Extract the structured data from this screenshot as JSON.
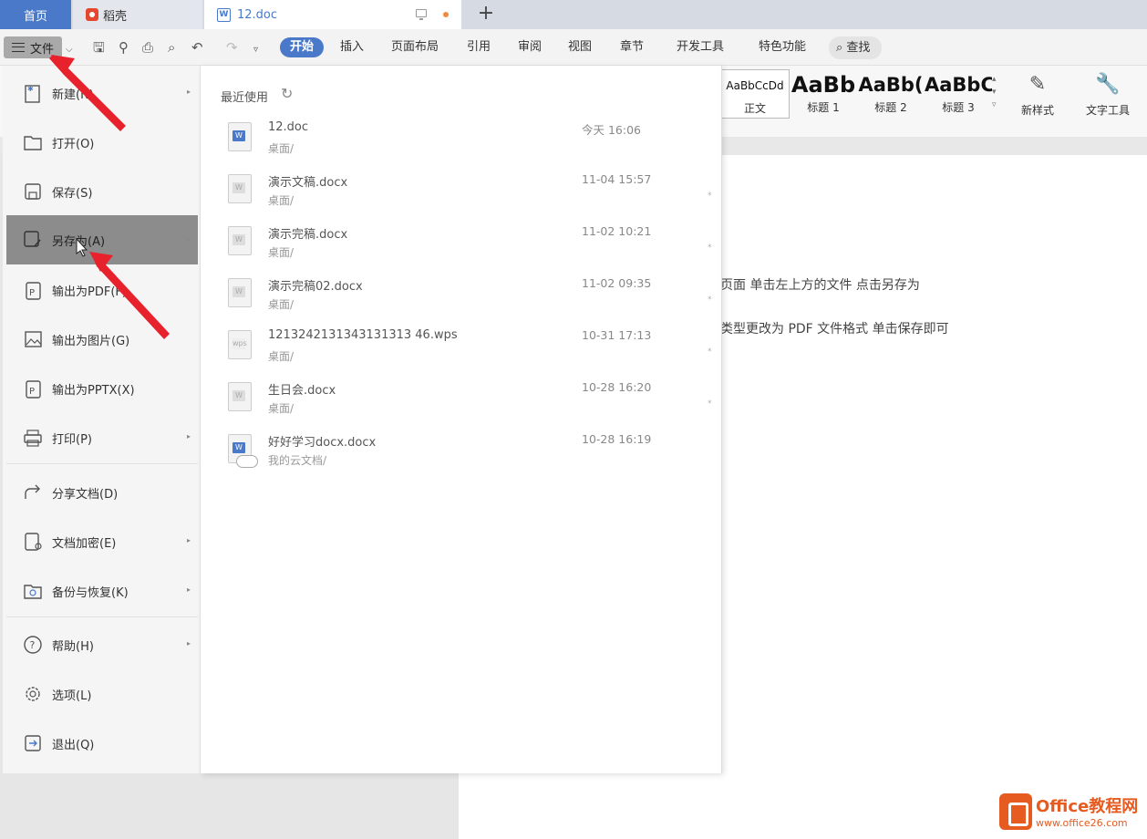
{
  "tabs": {
    "home": "首页",
    "daoke": "稻壳",
    "doc": "12.doc",
    "doc_icon": "W",
    "new_tab": "+"
  },
  "toolbar": {
    "file_label": "文件",
    "tabs": [
      "开始",
      "插入",
      "页面布局",
      "引用",
      "审阅",
      "视图",
      "章节",
      "开发工具",
      "特色功能"
    ],
    "find_label": "查找"
  },
  "ribbon": {
    "styles": [
      {
        "sample": "AaBbCcDd",
        "label": "正文"
      },
      {
        "sample": "AaBb",
        "label": "标题 1"
      },
      {
        "sample": "AaBb(",
        "label": "标题 2"
      },
      {
        "sample": "AaBbC(",
        "label": "标题 3"
      }
    ],
    "new_style": "新样式",
    "text_tools": "文字工具"
  },
  "document": {
    "line1": "页面   单击左上方的文件   点击另存为",
    "line2": "类型更改为 PDF 文件格式   单击保存即可"
  },
  "file_menu": {
    "items": [
      {
        "label": "新建(N)",
        "icon": "new-doc-icon",
        "arrow": true
      },
      {
        "label": "打开(O)",
        "icon": "folder-open-icon",
        "arrow": false
      },
      {
        "label": "保存(S)",
        "icon": "save-icon",
        "arrow": false
      },
      {
        "label": "另存为(A)",
        "icon": "save-as-icon",
        "arrow": true,
        "highlighted": true
      },
      {
        "label": "输出为PDF(F)",
        "icon": "export-pdf-icon",
        "arrow": false
      },
      {
        "label": "输出为图片(G)",
        "icon": "export-image-icon",
        "arrow": false
      },
      {
        "label": "输出为PPTX(X)",
        "icon": "export-pptx-icon",
        "arrow": false
      },
      {
        "label": "打印(P)",
        "icon": "print-icon",
        "arrow": true
      },
      {
        "label": "分享文档(D)",
        "icon": "share-icon",
        "arrow": false
      },
      {
        "label": "文档加密(E)",
        "icon": "encrypt-icon",
        "arrow": true
      },
      {
        "label": "备份与恢复(K)",
        "icon": "backup-icon",
        "arrow": true
      },
      {
        "label": "帮助(H)",
        "icon": "help-icon",
        "arrow": true
      },
      {
        "label": "选项(L)",
        "icon": "gear-icon",
        "arrow": false
      },
      {
        "label": "退出(Q)",
        "icon": "exit-icon",
        "arrow": false
      }
    ]
  },
  "recent": {
    "title": "最近使用",
    "files": [
      {
        "name": "12.doc",
        "path": "桌面/",
        "time": "今天 16:06",
        "type": "doc",
        "pin": false
      },
      {
        "name": "演示文稿.docx",
        "path": "桌面/",
        "time": "11-04 15:57",
        "type": "docx",
        "pin": true
      },
      {
        "name": "演示完稿.docx",
        "path": "桌面/",
        "time": "11-02 10:21",
        "type": "docx",
        "pin": true
      },
      {
        "name": "演示完稿02.docx",
        "path": "桌面/",
        "time": "11-02 09:35",
        "type": "docx",
        "pin": true
      },
      {
        "name": "1213242131343131313 46.wps",
        "path": "桌面/",
        "time": "10-31 17:13",
        "type": "wps",
        "pin": true
      },
      {
        "name": "生日会.docx",
        "path": "桌面/",
        "time": "10-28 16:20",
        "type": "docx",
        "pin": true
      },
      {
        "name": "好好学习docx.docx",
        "path": "我的云文档/",
        "time": "10-28 16:19",
        "type": "cloud",
        "pin": false
      }
    ]
  },
  "watermark": {
    "brand": "Office教程网",
    "url": "www.office26.com"
  },
  "colors": {
    "accent": "#4a79c9",
    "annotation": "#e8222d",
    "watermark": "#e65b20"
  }
}
